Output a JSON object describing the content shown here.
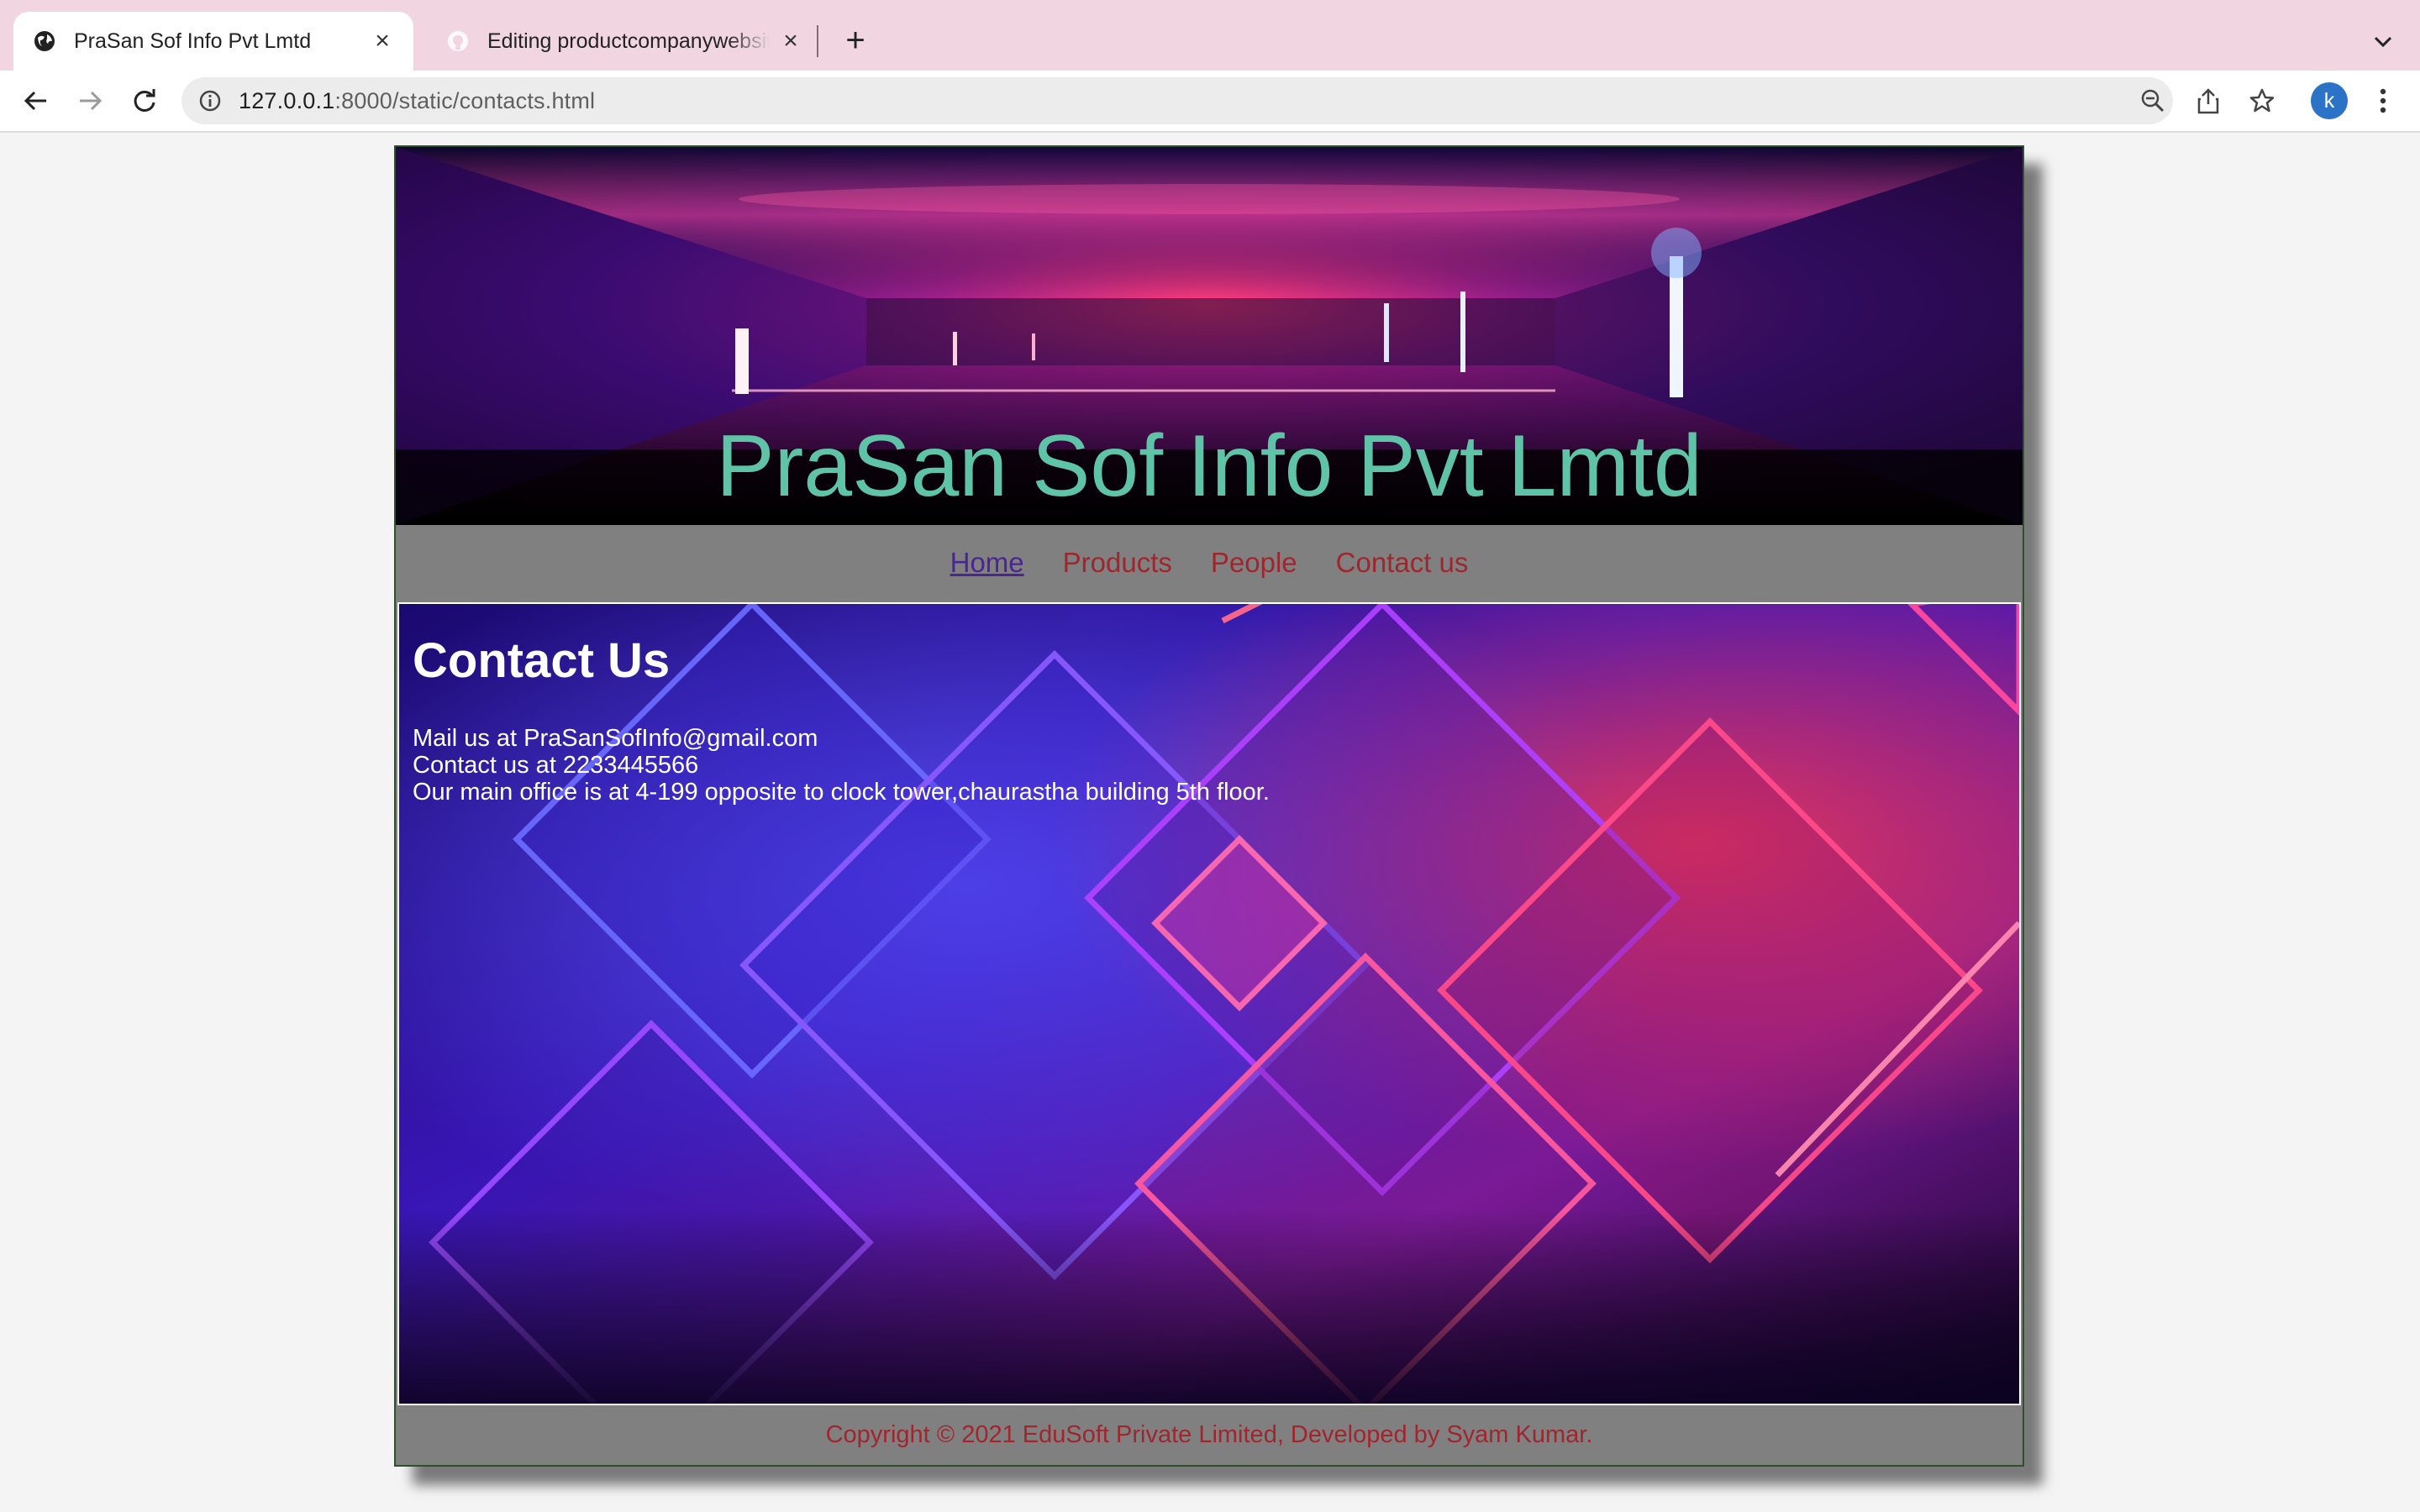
{
  "browser": {
    "tabs": [
      {
        "title": "PraSan Sof Info Pvt Lmtd",
        "active": true,
        "icon": "globe-icon"
      },
      {
        "title": "Editing productcompanywebsite",
        "active": false,
        "icon": "github-icon"
      }
    ],
    "url_host": "127.0.0.1",
    "url_rest": ":8000/static/contacts.html",
    "profile_initial": "k"
  },
  "page": {
    "site_title": "PraSan Sof Info Pvt Lmtd",
    "nav": [
      {
        "label": "Home",
        "visited": true
      },
      {
        "label": "Products",
        "visited": false
      },
      {
        "label": "People",
        "visited": false
      },
      {
        "label": "Contact us",
        "visited": false
      }
    ],
    "heading": "Contact Us",
    "contact_lines": [
      "Mail us at PraSanSofInfo@gmail.com",
      "Contact us at 2233445566",
      "Our main office is at 4-199 opposite to clock tower,chaurastha building 5th floor."
    ],
    "footer": "Copyright © 2021 EduSoft Private Limited, Developed by Syam Kumar."
  },
  "colors": {
    "tab_bar": "#f1d6e2",
    "site_title": "#5fc4a7",
    "nav_link": "#a0262e",
    "nav_visited": "#4b2692",
    "chrome_bg": "#808080"
  }
}
